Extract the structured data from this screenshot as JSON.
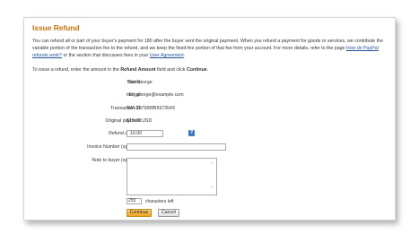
{
  "page": {
    "title": "Issue Refund",
    "intro_part1": "You can refund all or part of your buyer's payment for 180 after the buyer sent the original payment. When you refund a payment for goods or services, we contribute the variable portion of the transaction fee to the refund, and we keep the fixed-fee portion of that fee from your account. For more details, refer to the page ",
    "intro_link1": "How do PayPal refunds work?",
    "intro_part2": " or the section that discusses fees in your ",
    "intro_link2": "User Agreement",
    "intro_part3": ".",
    "instr_part1": "To issue a refund, enter the amount in the ",
    "instr_bold1": "Refund Amount",
    "instr_part2": " field and click ",
    "instr_bold2": "Continue",
    "instr_part3": "."
  },
  "details": {
    "name_label": "Name:",
    "name_value": "Trini George",
    "email_label": "Email:",
    "email_value": "trini_george@example.com",
    "txn_label": "Transaction ID:",
    "txn_value": "5WL15758WB597354X",
    "original_label": "Original payment:",
    "original_value": "$10.00 USD"
  },
  "form": {
    "refund_label": "Refund amount:",
    "refund_value": "10.00",
    "help_icon": "?",
    "invoice_label": "Invoice Number (optional):",
    "invoice_value": "",
    "note_label": "Note to buyer (optional):",
    "note_value": "",
    "chars_left_value": "255",
    "chars_left_label": "characters left"
  },
  "buttons": {
    "continue_label": "Continue",
    "cancel_label": "Cancel"
  },
  "colors": {
    "title": "#c8740b",
    "link": "#1f4f9e",
    "continue_button": "#f0a11d"
  }
}
